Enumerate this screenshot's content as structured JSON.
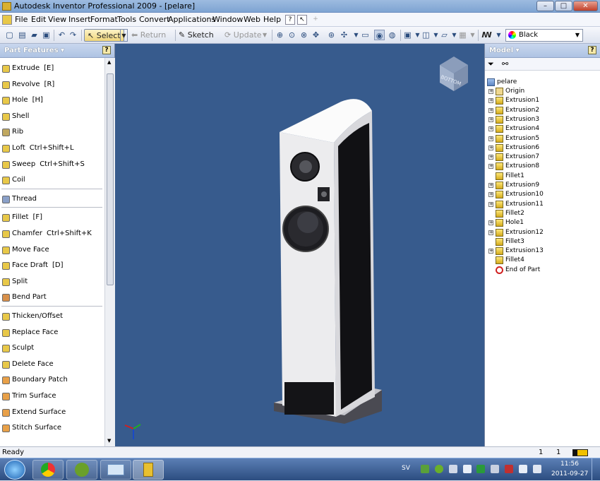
{
  "window": {
    "title": "Autodesk Inventor Professional 2009 - [pelare]",
    "btn_min": "–",
    "btn_max": "□",
    "btn_close": "✕"
  },
  "menu": [
    "File",
    "Edit",
    "View",
    "Insert",
    "Format",
    "Tools",
    "Convert",
    "Applications",
    "Window",
    "Web",
    "Help"
  ],
  "toolbar": {
    "select": "Select",
    "return": "Return",
    "sketch": "Sketch",
    "update": "Update",
    "color": "Black"
  },
  "left_panel": {
    "title": "Part Features ▾",
    "help": "?",
    "items": [
      {
        "label": "Extrude",
        "key": "[E]",
        "color": "#e8c848"
      },
      {
        "label": "Revolve",
        "key": "[R]",
        "color": "#e8c848"
      },
      {
        "label": "Hole",
        "key": "[H]",
        "color": "#e8c848"
      },
      {
        "label": "Shell",
        "key": "",
        "color": "#e8c848"
      },
      {
        "label": "Rib",
        "key": "",
        "color": "#c0a860"
      },
      {
        "label": "Loft",
        "key": "Ctrl+Shift+L",
        "color": "#e8c848"
      },
      {
        "label": "Sweep",
        "key": "Ctrl+Shift+S",
        "color": "#e8c848"
      },
      {
        "label": "Coil",
        "key": "",
        "color": "#e8c848"
      },
      {
        "label": "Thread",
        "key": "",
        "color": "#8aa0c8"
      },
      {
        "label": "Fillet",
        "key": "[F]",
        "color": "#e8c848"
      },
      {
        "label": "Chamfer",
        "key": "Ctrl+Shift+K",
        "color": "#e8c848"
      },
      {
        "label": "Move Face",
        "key": "",
        "color": "#e8c848"
      },
      {
        "label": "Face Draft",
        "key": "[D]",
        "color": "#e8c848"
      },
      {
        "label": "Split",
        "key": "",
        "color": "#e8c848"
      },
      {
        "label": "Bend Part",
        "key": "",
        "color": "#d8904a"
      },
      {
        "label": "Thicken/Offset",
        "key": "",
        "color": "#e8c848"
      },
      {
        "label": "Replace Face",
        "key": "",
        "color": "#e8c848"
      },
      {
        "label": "Sculpt",
        "key": "",
        "color": "#e8c848"
      },
      {
        "label": "Delete Face",
        "key": "",
        "color": "#e8c848"
      },
      {
        "label": "Boundary Patch",
        "key": "",
        "color": "#e8a048"
      },
      {
        "label": "Trim Surface",
        "key": "",
        "color": "#e8a048"
      },
      {
        "label": "Extend Surface",
        "key": "",
        "color": "#e8a048"
      },
      {
        "label": "Stitch Surface",
        "key": "",
        "color": "#e8a048"
      }
    ]
  },
  "viewcube": {
    "label": "BOTTOM"
  },
  "right_panel": {
    "title": "Model ▾",
    "help": "?",
    "root": "pelare",
    "nodes": [
      {
        "label": "Origin",
        "expand": "+",
        "icon": "folder"
      },
      {
        "label": "Extrusion1",
        "expand": "+",
        "icon": "feature"
      },
      {
        "label": "Extrusion2",
        "expand": "+",
        "icon": "feature"
      },
      {
        "label": "Extrusion3",
        "expand": "+",
        "icon": "feature"
      },
      {
        "label": "Extrusion4",
        "expand": "+",
        "icon": "feature"
      },
      {
        "label": "Extrusion5",
        "expand": "+",
        "icon": "feature"
      },
      {
        "label": "Extrusion6",
        "expand": "+",
        "icon": "feature"
      },
      {
        "label": "Extrusion7",
        "expand": "+",
        "icon": "feature"
      },
      {
        "label": "Extrusion8",
        "expand": "+",
        "icon": "feature"
      },
      {
        "label": "Fillet1",
        "expand": "",
        "icon": "feature"
      },
      {
        "label": "Extrusion9",
        "expand": "+",
        "icon": "feature"
      },
      {
        "label": "Extrusion10",
        "expand": "+",
        "icon": "feature"
      },
      {
        "label": "Extrusion11",
        "expand": "+",
        "icon": "feature"
      },
      {
        "label": "Fillet2",
        "expand": "",
        "icon": "feature"
      },
      {
        "label": "Hole1",
        "expand": "+",
        "icon": "feature"
      },
      {
        "label": "Extrusion12",
        "expand": "+",
        "icon": "feature"
      },
      {
        "label": "Fillet3",
        "expand": "",
        "icon": "feature"
      },
      {
        "label": "Extrusion13",
        "expand": "+",
        "icon": "feature"
      },
      {
        "label": "Fillet4",
        "expand": "",
        "icon": "feature"
      },
      {
        "label": "End of Part",
        "expand": "",
        "icon": "end"
      }
    ]
  },
  "status": {
    "text": "Ready",
    "num1": "1",
    "num2": "1"
  },
  "taskbar": {
    "lang": "SV",
    "time": "11:56",
    "date": "2011-09-27"
  }
}
